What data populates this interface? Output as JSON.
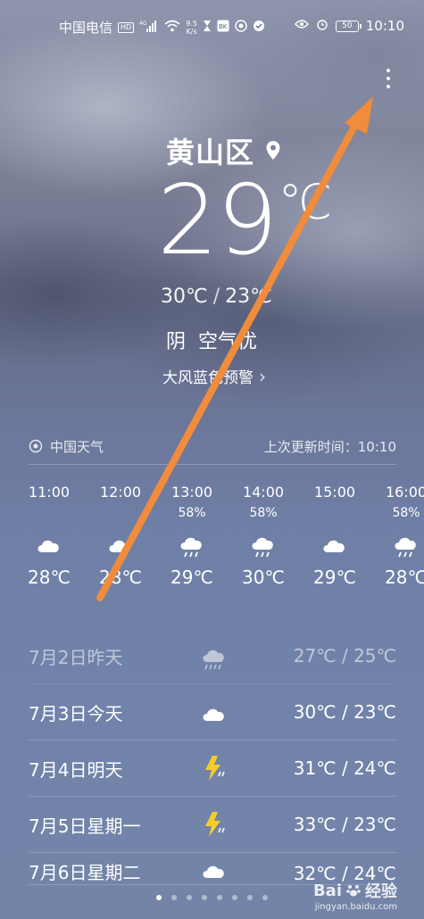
{
  "status_bar": {
    "carrier": "中国电信",
    "hd": "HD",
    "signal": "⁴ᴳ",
    "speed_value": "9.5",
    "speed_unit": "K/s",
    "battery": "50",
    "time": "10:10"
  },
  "location": {
    "name": "黄山区"
  },
  "current": {
    "temp": "29",
    "unit": "℃",
    "high": "30℃",
    "low": "23℃",
    "condition": "阴",
    "air_quality": "空气优",
    "warning": "大风蓝色预警"
  },
  "source": {
    "provider": "中国天气",
    "updated_label": "上次更新时间：",
    "updated_time": "10:10"
  },
  "hourly": [
    {
      "time": "11:00",
      "pop": "",
      "icon": "cloud-icon",
      "temp": "28℃"
    },
    {
      "time": "12:00",
      "pop": "",
      "icon": "cloud-icon",
      "temp": "28℃"
    },
    {
      "time": "13:00",
      "pop": "58%",
      "icon": "shower-icon",
      "temp": "29℃"
    },
    {
      "time": "14:00",
      "pop": "58%",
      "icon": "shower-icon",
      "temp": "30℃"
    },
    {
      "time": "15:00",
      "pop": "",
      "icon": "cloud-icon",
      "temp": "29℃"
    },
    {
      "time": "16:00",
      "pop": "58%",
      "icon": "shower-icon",
      "temp": "28℃"
    }
  ],
  "daily": [
    {
      "label": "7月2日昨天",
      "icon": "rain-icon",
      "range": "27℃ / 25℃"
    },
    {
      "label": "7月3日今天",
      "icon": "cloud-icon",
      "range": "30℃ / 23℃"
    },
    {
      "label": "7月4日明天",
      "icon": "thunder-icon",
      "range": "31℃ / 24℃"
    },
    {
      "label": "7月5日星期一",
      "icon": "thunder-icon",
      "range": "33℃ / 23℃"
    },
    {
      "label": "7月6日星期二",
      "icon": "cloud-icon",
      "range": "32℃ / 24℃"
    }
  ],
  "watermark": {
    "brand": "Bai",
    "brand_suffix": "经验",
    "url": "jingyan.baidu.com"
  },
  "colors": {
    "arrow": "#f08c3c",
    "text": "#ffffff",
    "lightning": "#f5cd2a"
  }
}
